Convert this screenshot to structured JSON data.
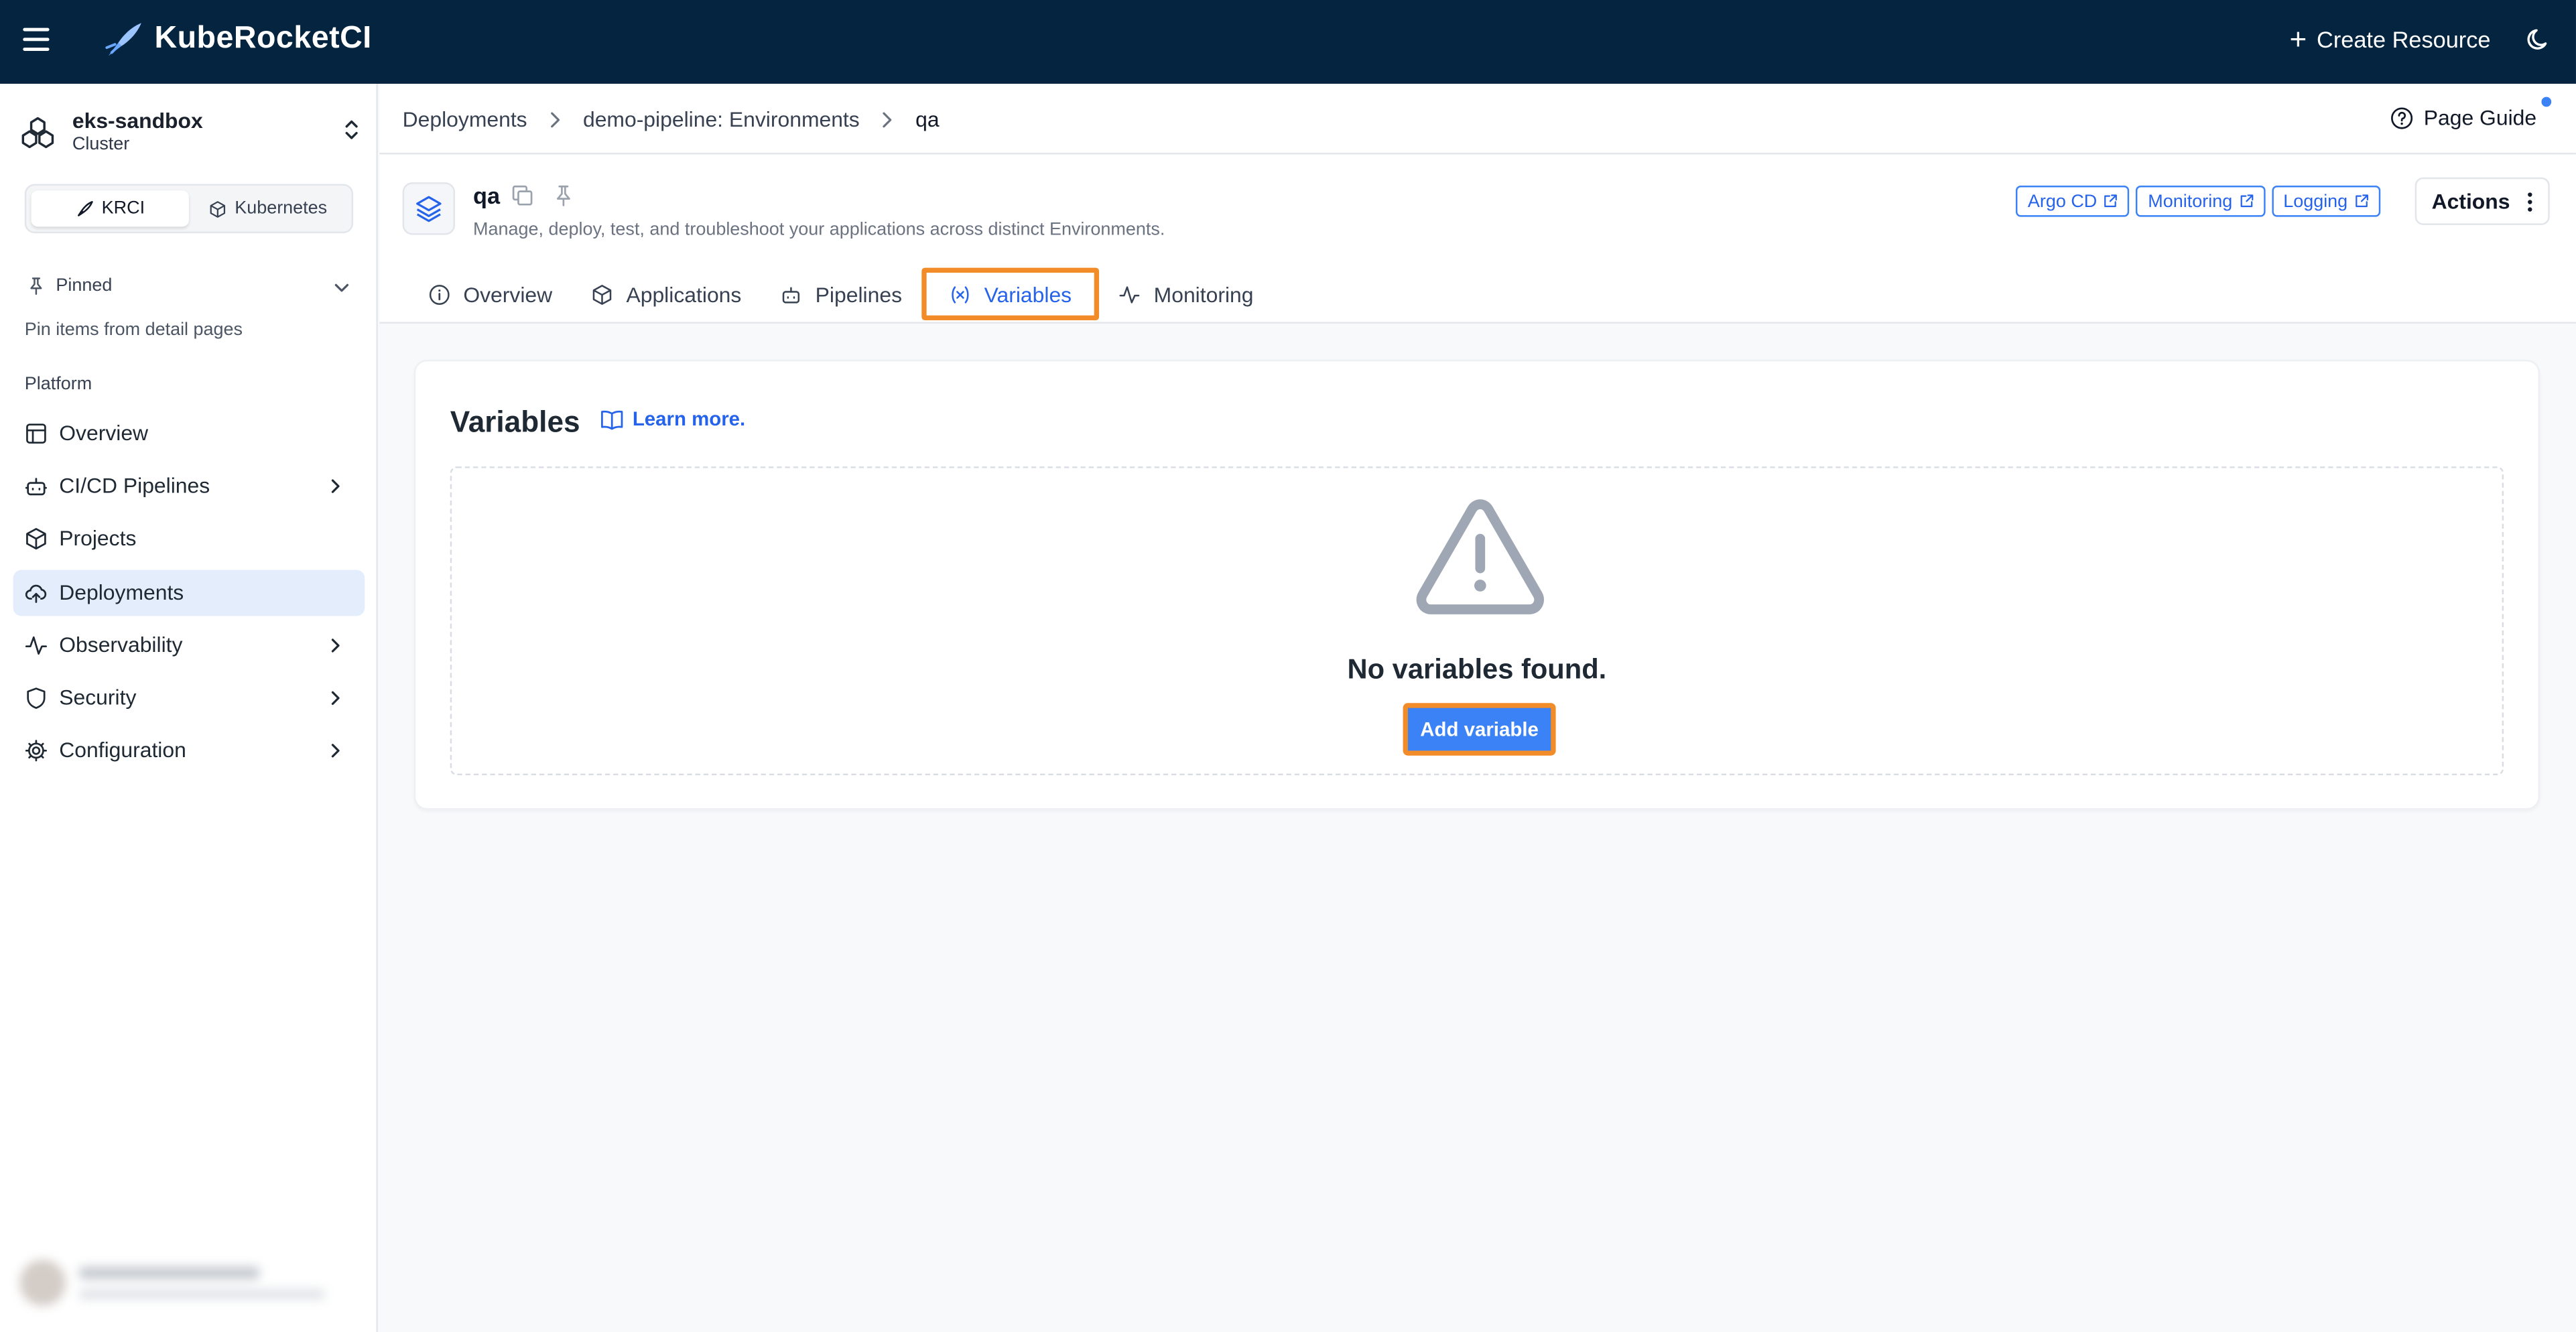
{
  "app": {
    "brand": "KubeRocketCI",
    "create_resource": "Create Resource"
  },
  "sidebar": {
    "cluster_name": "eks-sandbox",
    "cluster_type": "Cluster",
    "switcher": [
      "KRCI",
      "Kubernetes"
    ],
    "pinned_label": "Pinned",
    "pinned_hint": "Pin items from detail pages",
    "section_label": "Platform",
    "items": [
      {
        "label": "Overview",
        "icon": "layout-icon"
      },
      {
        "label": "CI/CD Pipelines",
        "icon": "bot-icon"
      },
      {
        "label": "Projects",
        "icon": "cube-icon"
      },
      {
        "label": "Deployments",
        "icon": "cloud-upload-icon"
      },
      {
        "label": "Observability",
        "icon": "activity-icon"
      },
      {
        "label": "Security",
        "icon": "shield-icon"
      },
      {
        "label": "Configuration",
        "icon": "gear-icon"
      }
    ]
  },
  "breadcrumb": {
    "items": [
      "Deployments",
      "demo-pipeline: Environments",
      "qa"
    ],
    "page_guide": "Page Guide"
  },
  "header": {
    "title": "qa",
    "description": "Manage, deploy, test, and troubleshoot your applications across distinct Environments.",
    "links": [
      "Argo CD",
      "Monitoring",
      "Logging"
    ],
    "actions": "Actions",
    "tabs": [
      "Overview",
      "Applications",
      "Pipelines",
      "Variables",
      "Monitoring"
    ],
    "active_tab": "Variables"
  },
  "content": {
    "title": "Variables",
    "learn_more": "Learn more.",
    "empty_text": "No variables found.",
    "add_button": "Add variable"
  },
  "colors": {
    "topbar": "#04243f",
    "accent": "#3b82f6",
    "highlight": "#f28c28",
    "active_nav": "#e3edfb"
  }
}
